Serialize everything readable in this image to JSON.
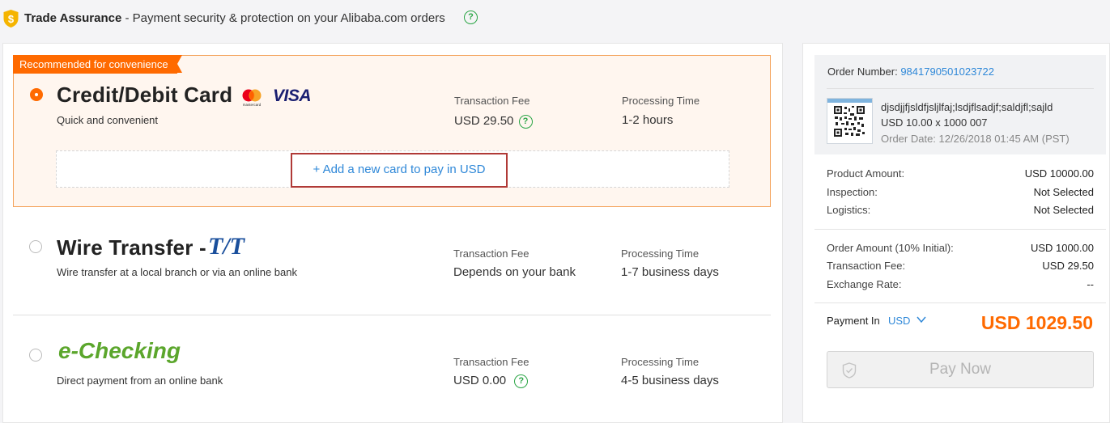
{
  "header": {
    "brand": "Trade Assurance",
    "tagline": " - Payment security & protection on your Alibaba.com orders"
  },
  "methods": [
    {
      "badge": "Recommended for convenience",
      "title": "Credit/Debit Card",
      "subtitle": "Quick and convenient",
      "fee_label": "Transaction Fee",
      "fee_value": "USD 29.50",
      "time_label": "Processing Time",
      "time_value": "1-2 hours",
      "selected": true,
      "logos": [
        "mastercard-logo",
        "visa-logo"
      ],
      "brand_text": {
        "mastercard": "mastercard",
        "visa": "VISA"
      },
      "add_card_label": "+ Add a new card to pay in USD"
    },
    {
      "title": "Wire Transfer - ",
      "logo_text": "T/T",
      "subtitle": "Wire transfer at a local branch or via an online bank",
      "fee_label": "Transaction Fee",
      "fee_value": "Depends on your bank",
      "time_label": "Processing Time",
      "time_value": "1-7 business days",
      "selected": false
    },
    {
      "title": "e-Checking",
      "subtitle": "Direct payment from an online bank",
      "fee_label": "Transaction Fee",
      "fee_value": "USD 0.00",
      "time_label": "Processing Time",
      "time_value": "4-5 business days",
      "selected": false
    }
  ],
  "order": {
    "number_label": "Order Number: ",
    "number_value": "9841790501023722",
    "product_name": "djsdjjfjsldfjsljlfaj;lsdjflsadjf;saldjfl;sajld",
    "qty_line": "USD 10.00 x 1000 007",
    "date_line": "Order Date: 12/26/2018 01:45 AM (PST)"
  },
  "summary": {
    "product_amount_label": "Product Amount:",
    "product_amount_value": "USD 10000.00",
    "inspection_label": "Inspection:",
    "inspection_value": "Not Selected",
    "logistics_label": "Logistics:",
    "logistics_value": "Not Selected",
    "order_amount_label": "Order Amount (10% Initial):",
    "order_amount_value": "USD 1000.00",
    "fee_label": "Transaction Fee:",
    "fee_value": "USD 29.50",
    "rate_label": "Exchange Rate:",
    "rate_value": "--"
  },
  "payment": {
    "pay_in_label": "Payment In",
    "currency": "USD",
    "total": "USD 1029.50",
    "pay_button": "Pay Now"
  },
  "icons": {
    "help": "?",
    "shield": "shield-icon",
    "chevron": "chevron-down-icon"
  },
  "colors": {
    "accent": "#ff6a00",
    "link": "#2f88d8",
    "help": "#2aa545",
    "echeck": "#5ba62c",
    "tt": "#1a4f9c",
    "visa": "#1a1f71",
    "highlight_border": "#b03a37"
  }
}
